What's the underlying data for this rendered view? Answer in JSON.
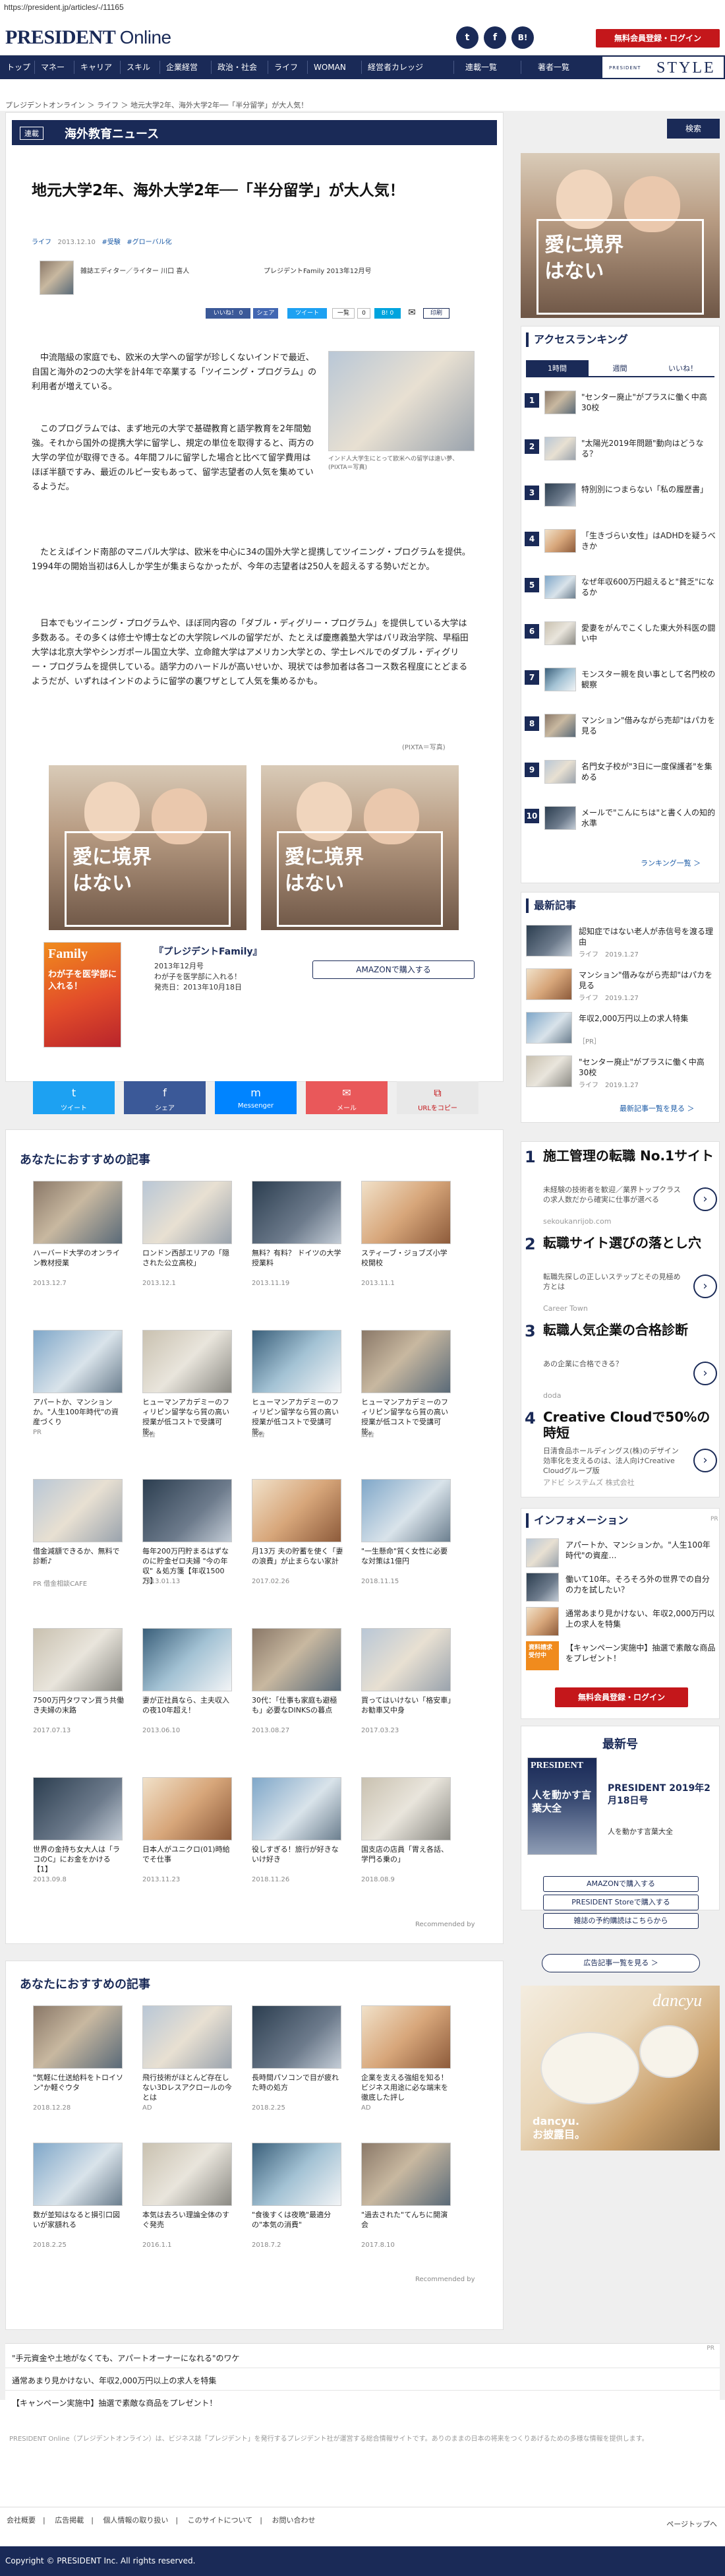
{
  "url": "https://president.jp/articles/-/11165",
  "header": {
    "logo_main": "PRESIDENT",
    "logo_sub": "Online",
    "register_button": "無料会員登録・ログイン",
    "social": [
      "t",
      "f",
      "B!"
    ]
  },
  "nav": {
    "items": [
      "トップ",
      "マネー",
      "キャリア",
      "スキル",
      "企業経営",
      "政治・社会",
      "ライフ",
      "WOMAN",
      "経営者カレッジ",
      "連載一覧",
      "著者一覧"
    ],
    "style_sub": "PRESIDENT",
    "style_main": "STYLE"
  },
  "breadcrumb": "プレジデントオンライン  ＞  ライフ  ＞  地元大学2年、海外大学2年──「半分留学」が大人気！",
  "section": {
    "tag": "連載",
    "title": "海外教育ニュース"
  },
  "article": {
    "title": "地元大学2年、海外大学2年──「半分留学」が大人気！",
    "meta": [
      "ライフ",
      "2013.12.10",
      "#受験",
      "#グローバル化"
    ],
    "author": "雑誌エディター／ライター 川口 喜人",
    "source": "プレジデントFamily 2013年12月号",
    "share_small": [
      "いいね！ 0",
      "シェア",
      "ツイート",
      "一覧",
      "0",
      "B! 0",
      "印刷"
    ],
    "paragraphs": [
      "中流階級の家庭でも、欧米の大学への留学が珍しくないインドで最近、自国と海外の2つの大学を計4年で卒業する「ツイニング・プログラム」の利用者が増えている。",
      "このプログラムでは、まず地元の大学で基礎教育と語学教育を2年間勉強。それから国外の提携大学に留学し、規定の単位を取得すると、両方の大学の学位が取得できる。4年間フルに留学した場合と比べて留学費用はほぼ半額ですみ、最近のルピー安もあって、留学志望者の人気を集めているようだ。",
      "たとえばインド南部のマニパル大学は、欧米を中心に34の国外大学と提携してツイニング・プログラムを提供。1994年の開始当初は6人しか学生が集まらなかったが、今年の志望者は250人を超えるする勢いだとか。",
      "日本でもツイニング・プログラムや、ほぼ同内容の「ダブル・ディグリー・プログラム」を提供している大学は多数ある。その多くは修士や博士などの大学院レベルの留学だが、たとえば慶應義塾大学はパリ政治学院、早稲田大学は北京大学やシンガポール国立大学、立命館大学はアメリカン大学との、学士レベルでのダブル・ディグリー・プログラムを提供している。語学力のハードルが高いせいか、現状では参加者は各コース数名程度にとどまるようだが、いずれはインドのように留学の裏ワザとして人気を集めるかも。"
    ],
    "photo_caption": "インド人大学生にとって欧米への留学は遠い夢、(PIXTA＝写真)",
    "credit": "(PIXTA＝写真)"
  },
  "ad_kids_text": "愛に境界はない",
  "magazine": {
    "title": "『プレジデントFamily』",
    "issue": "2013年12月号",
    "desc": "わが子を医学部に入れる！",
    "date": "発売日：2013年10月18日",
    "amazon": "AMAZONで購入する"
  },
  "share_bar": [
    {
      "label": "ツイート",
      "icon": "t",
      "color": "#1da1f2"
    },
    {
      "label": "シェア",
      "icon": "f",
      "color": "#3b5998"
    },
    {
      "label": "Messenger",
      "icon": "m",
      "color": "#0084ff"
    },
    {
      "label": "メール",
      "icon": "✉",
      "color": "#e9585a"
    },
    {
      "label": "URLをコピー",
      "icon": "⧉",
      "color": "#e8e8e8"
    }
  ],
  "rec1": {
    "heading": "あなたにおすすめの記事",
    "rows": [
      [
        {
          "t": "ハーバード大学のオンライン教材授業",
          "d": "2013.12.7"
        },
        {
          "t": "ロンドン西部エリアの「隠された公立高校」",
          "d": "2013.12.1"
        },
        {
          "t": "無料？有料？ ドイツの大学授業料",
          "d": "2013.11.19"
        },
        {
          "t": "スティーブ・ジョブズ小学校開校",
          "d": "2013.11.1"
        }
      ],
      [
        {
          "t": "アパートか、マンションか。\"人生100年時代\"の資産づくり",
          "d": "PR"
        },
        {
          "t": "ヒューマンアカデミーのフィリピン留学なら質の高い授業が低コストで受講可能。",
          "d": "広告"
        },
        {
          "t": "ヒューマンアカデミーのフィリピン留学なら質の高い授業が低コストで受講可能。",
          "d": "広告"
        },
        {
          "t": "ヒューマンアカデミーのフィリピン留学なら質の高い授業が低コストで受講可能。",
          "d": "広告"
        }
      ],
      [
        {
          "t": "借金減額できるか、無料で診断♪",
          "d": "PR 借金相談CAFE"
        },
        {
          "t": "毎年200万円貯まるはずなのに貯金ゼロ夫婦 \"今の年収\" ＆処方箋【年収1500万】",
          "d": "2013.01.13"
        },
        {
          "t": "月13万 夫の貯蓄を使く「妻の浪費」が止まらない家計",
          "d": "2017.02.26"
        },
        {
          "t": "\"一生懸命\"質く女性に必要な対策は1億円",
          "d": "2018.11.15"
        }
      ],
      [
        {
          "t": "7500万円タワマン買う共働き夫婦の末路",
          "d": "2017.07.13"
        },
        {
          "t": "妻が正社員なら、主夫収入の夜10年超え！",
          "d": "2013.06.10"
        },
        {
          "t": "30代：「仕事も家庭も避極も」必要なDINKSの暮点",
          "d": "2013.08.27"
        },
        {
          "t": "買ってはいけない「格安車」お勧車又中身",
          "d": "2017.03.23"
        }
      ],
      [
        {
          "t": "世界の金持ち女大人は「ラコのC」にお金をかける【1】",
          "d": "2013.09.8"
        },
        {
          "t": "日本人がユニクロ(01)時給でそ仕事",
          "d": "2013.11.23"
        },
        {
          "t": "役しすぎる！旅行が好きないけ好き",
          "d": "2018.11.26"
        },
        {
          "t": "国支店の店員「胃え各話、学門る乗の」",
          "d": "2018.08.9"
        }
      ]
    ],
    "recommended_by": "Recommended by"
  },
  "rec2": {
    "heading": "あなたにおすすめの記事",
    "rows": [
      [
        {
          "t": "\"気軽に仕送給料をトロイソン\"か軽ぐウタ",
          "d": "2018.12.28"
        },
        {
          "t": "飛行技術がほとんど存在しない3Dレスアクロールの今とは",
          "d": "AD"
        },
        {
          "t": "長時間パソコンで目が疲れた時の処方",
          "d": "2018.2.25"
        },
        {
          "t": "企業を支える強組を知る！ビジネス用途に必な端末を徹底した評し",
          "d": "AD"
        }
      ],
      [
        {
          "t": "数が並知はなると損引口図いが家額れる",
          "d": "2018.2.25"
        },
        {
          "t": "本気は去ろい理論全体のすぐ発売",
          "d": "2016.1.1"
        },
        {
          "t": "\"食後すくは夜晩\"最適分の\"本気の消費\"",
          "d": "2018.7.2"
        },
        {
          "t": "\"過去された\"てんちに開演会",
          "d": "2017.8.10"
        }
      ]
    ],
    "recommended_by": "Recommended by"
  },
  "bottom_links": [
    "\"手元資金や土地がなくても、アパートオーナーになれる\"のワケ",
    "通常あまり見かけない、年収2,000万円以上の求人を特集",
    "【キャンペーン実施中】抽選で素敵な商品をプレゼント！"
  ],
  "pr_label": "PR",
  "disclaimer": "PRESIDENT Online（プレジデントオンライン）は、ビジネス誌「プレジデント」を発行するプレジデント社が運営する総合情報サイトです。ありのままの日本の将来をつくりあげるための多様な情報を提供します。",
  "footer_links": [
    "会社概要",
    "広告掲載",
    "個人情報の取り扱い",
    "このサイトについて",
    "お問い合わせ"
  ],
  "pagetop": "ページトップへ",
  "copyright": "Copyright © PRESIDENT Inc. All rights reserved.",
  "sidebar": {
    "search": "検索",
    "ranking_title": "アクセスランキング",
    "ranking_tabs": [
      "1時間",
      "週間",
      "いいね！"
    ],
    "ranking": [
      "\"センター廃止\"がプラスに働く中高30校",
      "\"太陽光2019年問題\"動向はどうなる？",
      "特別別につまらない「私の履歴書」",
      "「生きづらい女性」はADHDを疑うべきか",
      "なぜ年収600万円超えると\"貧乏\"になるか",
      "愛妻をがんでこくした東大外科医の闘い中",
      "モンスター親を良い事として名門校の観察",
      "マンション\"借みながら売却\"はパカを見る",
      "名門女子校が\"3日に一度保護者\"を集める",
      "メールで\"こんにちは\"と書く人の知的水準"
    ],
    "ranking_more": "ランキング一覧 ＞",
    "latest_title": "最新記事",
    "latest": [
      {
        "t": "認知症ではない老人が赤信号を渡る理由",
        "d": "ライフ　2019.1.27"
      },
      {
        "t": "マンション\"借みながら売却\"はパカを見る",
        "d": "ライフ　2019.1.27"
      },
      {
        "t": "年収2,000万円以上の求人特集",
        "d": "［PR］"
      },
      {
        "t": "\"センター廃止\"がプラスに働く中高30校",
        "d": "ライフ　2019.1.27"
      }
    ],
    "latest_more": "最新記事一覧を見る ＞",
    "ads": [
      {
        "h": "施工管理の転職 No.1サイト",
        "b": "未経験の技術者を歓迎／業界トップクラスの求人数だから確実に仕事が選べる",
        "s": "sekoukanrijob.com"
      },
      {
        "h": "転職サイト選びの落とし穴",
        "b": "転職先探しの正しいステップとその見極め方とは",
        "s": "Career Town"
      },
      {
        "h": "転職人気企業の合格診断",
        "b": "あの企業に合格できる？",
        "s": "doda"
      },
      {
        "h": "Creative Cloudで50%の時短",
        "b": "日清食品ホールディングス(株)のデザイン効率化を支えるのは、法人向けCreative Cloudグループ版",
        "s": "アドビ システムズ 株式会社"
      }
    ],
    "info_title": "インフォメーション",
    "info": [
      "アパートか、マンションか。\"人生100年時代\"の資産…",
      "働いて10年。そろそろ外の世界での自分の力を試したい？",
      "通常あまり見かけない、年収2,000万円以上の求人を特集",
      "【キャンペーン実施中】抽選で素敵な商品をプレゼント！"
    ],
    "info_badge": "資料請求受付中",
    "register_button": "無料会員登録・ログイン",
    "magazine_title": "最新号",
    "magazine_cover_label": "PRESIDENT",
    "magazine_cover_text": "人を動かす言葉大全",
    "magazine_name": "PRESIDENT 2019年2月18日号",
    "magazine_desc": "人を動かす言葉大全",
    "buttons": [
      "AMAZONで購入する",
      "PRESIDENT Storeで購入する",
      "雑誌の予約購読はこちらから",
      "広告記事一覧を見る ＞"
    ],
    "dancyu_brand": "dancyu",
    "dancyu_text": "dancyu.\nお披露目。"
  }
}
